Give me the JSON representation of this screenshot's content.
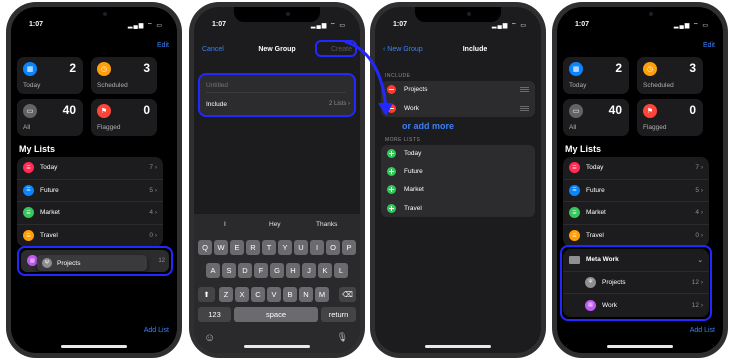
{
  "status": {
    "time": "1:07",
    "icons": "▂▄▆ ⌔ ▭"
  },
  "colors": {
    "accent": "#3a82f7",
    "highlight": "#2328ff",
    "annotation": "#3b7ff5"
  },
  "panel1": {
    "edit": "Edit",
    "cards": [
      {
        "label": "Today",
        "count": "2",
        "color": "#0a84ff",
        "icon": "calendar-icon",
        "glyph": "▦"
      },
      {
        "label": "Scheduled",
        "count": "3",
        "color": "#ff9f0a",
        "icon": "clock-icon",
        "glyph": "◷"
      },
      {
        "label": "All",
        "count": "40",
        "color": "#636366",
        "icon": "tray-icon",
        "glyph": "▭"
      },
      {
        "label": "Flagged",
        "count": "0",
        "color": "#ff453a",
        "icon": "flag-icon",
        "glyph": "⚑"
      }
    ],
    "my_lists": "My Lists",
    "lists": [
      {
        "name": "Today",
        "count": "7",
        "color": "#ff2d55"
      },
      {
        "name": "Future",
        "count": "5",
        "color": "#0a84ff"
      },
      {
        "name": "Market",
        "count": "4",
        "color": "#34c759"
      },
      {
        "name": "Travel",
        "count": "0",
        "color": "#ff9f0a"
      }
    ],
    "drag": {
      "name": "Projects",
      "count": "12"
    },
    "add_list": "Add List"
  },
  "panel2": {
    "cancel": "Cancel",
    "title": "New Group",
    "create": "Create",
    "name_placeholder": "Untitled",
    "include": "Include",
    "include_value": "2 Lists",
    "suggestions": [
      "I",
      "Hey",
      "Thanks"
    ],
    "rows": [
      [
        "Q",
        "W",
        "E",
        "R",
        "T",
        "Y",
        "U",
        "I",
        "O",
        "P"
      ],
      [
        "A",
        "S",
        "D",
        "F",
        "G",
        "H",
        "J",
        "K",
        "L"
      ],
      [
        "Z",
        "X",
        "C",
        "V",
        "B",
        "N",
        "M"
      ]
    ],
    "shift": "⬆",
    "backspace": "⌫",
    "num": "123",
    "space": "space",
    "return": "return",
    "emoji": "☺",
    "mic": "🎙"
  },
  "panel3": {
    "back": "New Group",
    "title": "Include",
    "include_header": "INCLUDE",
    "included": [
      "Projects",
      "Work"
    ],
    "annotation": "or add more",
    "more_header": "MORE LISTS",
    "more": [
      "Today",
      "Future",
      "Market",
      "Travel"
    ]
  },
  "panel4": {
    "edit": "Edit",
    "group": "Meta Work",
    "group_items": [
      {
        "name": "Projects",
        "count": "12",
        "color": "#8e8e93"
      },
      {
        "name": "Work",
        "count": "12",
        "color": "#bf5af2"
      }
    ],
    "add_list": "Add List"
  }
}
